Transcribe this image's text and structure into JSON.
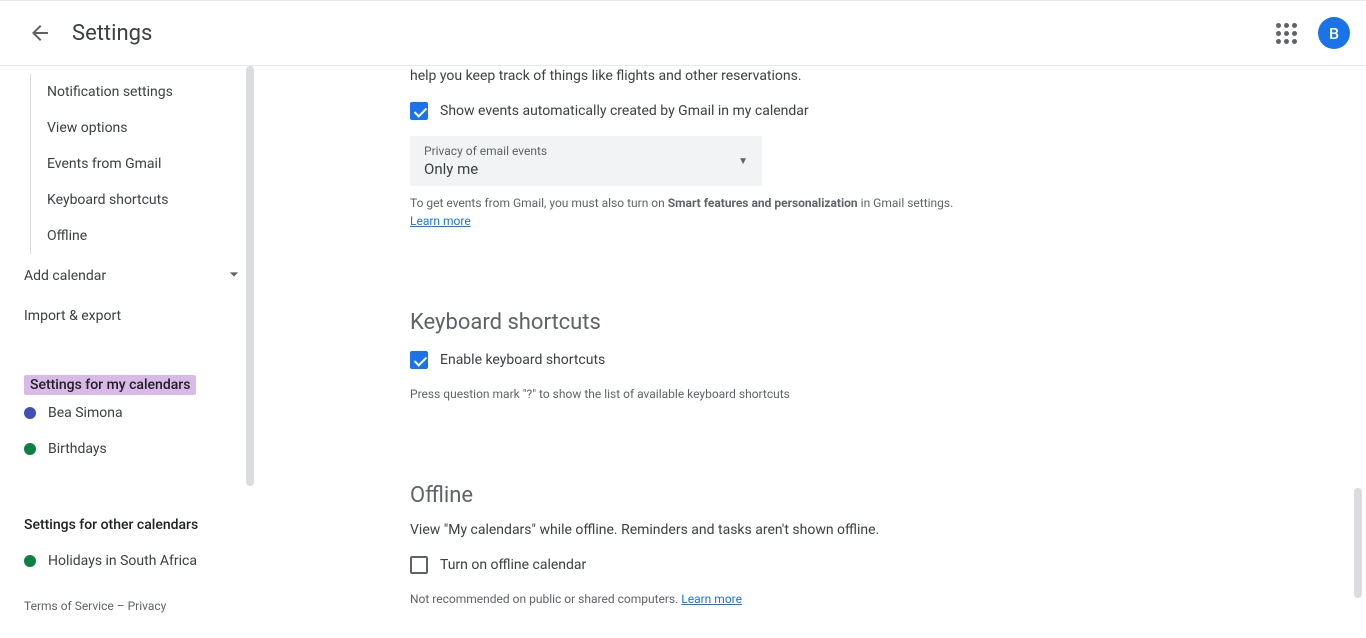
{
  "header": {
    "title": "Settings",
    "avatar_initial": "B"
  },
  "sidebar": {
    "subitems": [
      "Notification settings",
      "View options",
      "Events from Gmail",
      "Keyboard shortcuts",
      "Offline"
    ],
    "add_calendar": "Add calendar",
    "import_export": "Import & export",
    "my_calendars_heading": "Settings for my calendars",
    "my_calendars": [
      {
        "label": "Bea Simona",
        "color": "#3f51b5"
      },
      {
        "label": "Birthdays",
        "color": "#0b8043"
      }
    ],
    "other_calendars_heading": "Settings for other calendars",
    "other_calendars": [
      {
        "label": "Holidays in South Africa",
        "color": "#0b8043"
      }
    ],
    "footer": {
      "terms": "Terms of Service",
      "separator": " – ",
      "privacy": "Privacy"
    }
  },
  "main": {
    "gmail_desc": "help you keep track of things like flights and other reservations.",
    "gmail_checkbox": "Show events automatically created by Gmail in my calendar",
    "privacy_dropdown": {
      "label": "Privacy of email events",
      "value": "Only me"
    },
    "gmail_help_pre": "To get events from Gmail, you must also turn on ",
    "gmail_help_strong": "Smart features and personalization",
    "gmail_help_post": " in Gmail settings.",
    "learn_more": "Learn more",
    "keyboard": {
      "title": "Keyboard shortcuts",
      "checkbox": "Enable keyboard shortcuts",
      "help": "Press question mark \"?\" to show the list of available keyboard shortcuts"
    },
    "offline": {
      "title": "Offline",
      "desc": "View \"My calendars\" while offline. Reminders and tasks aren't shown offline.",
      "checkbox": "Turn on offline calendar",
      "help": "Not recommended on public or shared computers. "
    }
  }
}
